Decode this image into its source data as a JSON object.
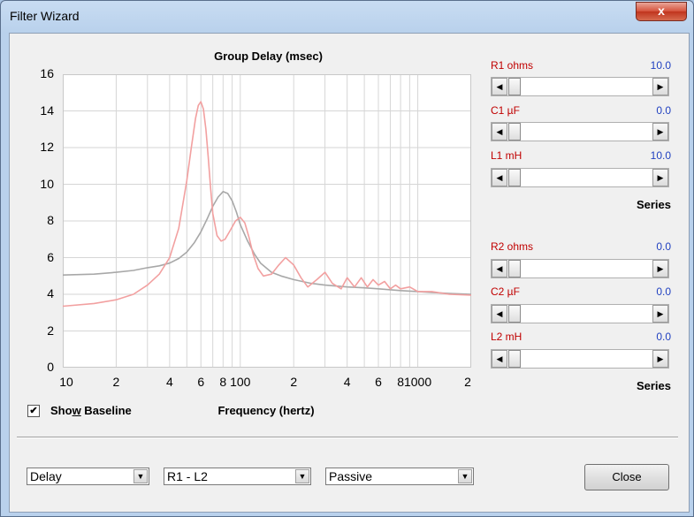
{
  "window": {
    "title": "Filter Wizard",
    "close_glyph": "x"
  },
  "chart_data": {
    "type": "line",
    "title": "Group Delay (msec)",
    "xlabel": "Frequency (hertz)",
    "xscale": "log",
    "xlim": [
      10,
      2000
    ],
    "ylim": [
      0,
      16
    ],
    "y_ticks": [
      "0",
      "2",
      "4",
      "6",
      "8",
      "10",
      "12",
      "14",
      "16"
    ],
    "x_ticks": [
      {
        "value": 10,
        "label": "10"
      },
      {
        "value": 20,
        "label": "2"
      },
      {
        "value": 40,
        "label": "4"
      },
      {
        "value": 60,
        "label": "6"
      },
      {
        "value": 80,
        "label": "8"
      },
      {
        "value": 100,
        "label": "100"
      },
      {
        "value": 200,
        "label": "2"
      },
      {
        "value": 400,
        "label": "4"
      },
      {
        "value": 600,
        "label": "6"
      },
      {
        "value": 800,
        "label": "8"
      },
      {
        "value": 1000,
        "label": "1000"
      },
      {
        "value": 2000,
        "label": "2"
      }
    ],
    "grid": true,
    "series": [
      {
        "color": "#a8a8a8",
        "x": [
          10,
          15,
          20,
          25,
          30,
          35,
          40,
          45,
          50,
          55,
          60,
          65,
          70,
          75,
          80,
          85,
          90,
          95,
          100,
          110,
          120,
          130,
          150,
          170,
          200,
          250,
          300,
          400,
          500,
          600,
          800,
          1000,
          1200,
          1500,
          2000
        ],
        "y": [
          5.05,
          5.1,
          5.2,
          5.3,
          5.45,
          5.55,
          5.7,
          5.95,
          6.3,
          6.8,
          7.4,
          8.1,
          8.8,
          9.3,
          9.6,
          9.5,
          9.1,
          8.5,
          7.8,
          6.9,
          6.2,
          5.7,
          5.2,
          5.0,
          4.8,
          4.6,
          4.5,
          4.4,
          4.35,
          4.3,
          4.2,
          4.15,
          4.1,
          4.05,
          4.0
        ]
      },
      {
        "color": "#f2a0a0",
        "x": [
          10,
          15,
          20,
          25,
          30,
          35,
          40,
          45,
          50,
          53,
          56,
          58,
          60,
          62,
          64,
          66,
          68,
          70,
          74,
          78,
          82,
          88,
          94,
          100,
          106,
          112,
          118,
          126,
          135,
          150,
          165,
          180,
          200,
          220,
          240,
          270,
          300,
          330,
          370,
          400,
          440,
          480,
          520,
          560,
          600,
          650,
          700,
          750,
          800,
          900,
          1000,
          1200,
          1500,
          2000
        ],
        "y": [
          3.35,
          3.5,
          3.7,
          4.0,
          4.5,
          5.1,
          6.0,
          7.6,
          10.2,
          12.0,
          13.6,
          14.3,
          14.5,
          14.1,
          13.0,
          11.5,
          9.8,
          8.4,
          7.2,
          6.9,
          7.0,
          7.5,
          8.0,
          8.2,
          7.9,
          7.1,
          6.2,
          5.4,
          5.0,
          5.1,
          5.6,
          6.0,
          5.6,
          4.9,
          4.4,
          4.8,
          5.2,
          4.6,
          4.3,
          4.9,
          4.4,
          4.9,
          4.4,
          4.8,
          4.5,
          4.7,
          4.3,
          4.5,
          4.3,
          4.4,
          4.15,
          4.15,
          4.0,
          3.95
        ]
      }
    ]
  },
  "show_baseline": {
    "label_pre": "Sho",
    "label_mnemonic": "w",
    "label_post": " Baseline",
    "checked_glyph": "✔"
  },
  "groups": [
    {
      "params": [
        {
          "label": "R1  ohms",
          "value": "10.0"
        },
        {
          "label": "C1  µF",
          "value": "0.0"
        },
        {
          "label": "L1  mH",
          "value": "10.0"
        }
      ],
      "series_label": "Series"
    },
    {
      "params": [
        {
          "label": "R2  ohms",
          "value": "0.0"
        },
        {
          "label": "C2  µF",
          "value": "0.0"
        },
        {
          "label": "L2  mH",
          "value": "0.0"
        }
      ],
      "series_label": "Series"
    }
  ],
  "scroll_glyphs": {
    "left": "◀",
    "right": "▶"
  },
  "dropdowns": {
    "mode": "Delay",
    "range": "R1 - L2",
    "type": "Passive",
    "arrow": "▼"
  },
  "close_button": "Close"
}
